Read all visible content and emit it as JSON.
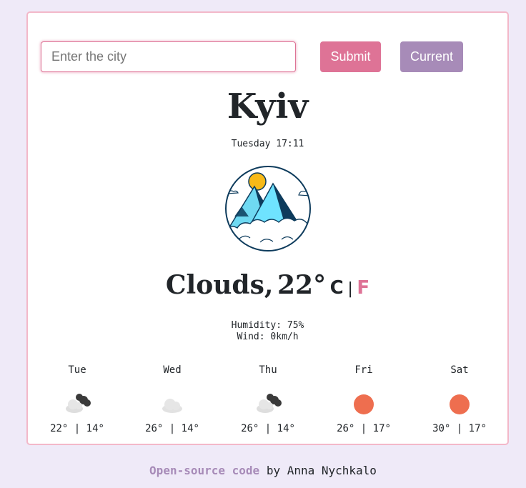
{
  "search": {
    "placeholder": "Enter the city"
  },
  "buttons": {
    "submit_label": "Submit",
    "current_label": "Current"
  },
  "city": "Kyiv",
  "datetime": "Tuesday 17:11",
  "current": {
    "description": "Clouds,",
    "temperature": "22°",
    "unit_c": "C",
    "unit_sep": "|",
    "unit_f": "F",
    "icon": "mountain-sun-clouds-icon"
  },
  "details": {
    "humidity": "Humidity: 75%",
    "wind": "Wind: 0km/h"
  },
  "forecast": [
    {
      "day": "Tue",
      "icon": "broken-clouds-icon",
      "temps": "22° | 14°"
    },
    {
      "day": "Wed",
      "icon": "cloud-icon",
      "temps": "26° | 14°"
    },
    {
      "day": "Thu",
      "icon": "broken-clouds-icon",
      "temps": "26° | 14°"
    },
    {
      "day": "Fri",
      "icon": "sun-icon",
      "temps": "26° | 17°"
    },
    {
      "day": "Sat",
      "icon": "sun-icon",
      "temps": "30° | 17°"
    }
  ],
  "footer": {
    "link_text": "Open-source code",
    "author_text": "by Anna Nychkalo"
  },
  "colors": {
    "accent": "#de7396",
    "secondary": "#a78bb8",
    "background": "#efeaf8",
    "sun": "#ee6e4f"
  }
}
